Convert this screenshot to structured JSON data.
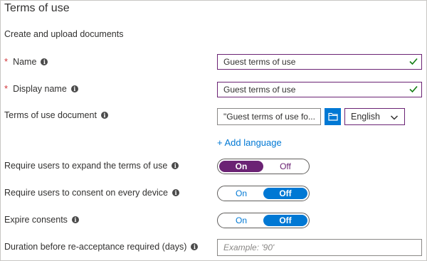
{
  "section": {
    "title": "Terms of use",
    "subtitle": "Create and upload documents"
  },
  "fields": {
    "name": {
      "label": "Name",
      "required": true,
      "value": "Guest terms of use"
    },
    "display_name": {
      "label": "Display name",
      "required": true,
      "value": "Guest terms of use"
    },
    "document": {
      "label": "Terms of use document",
      "file_value": "\"Guest terms of use fo...",
      "language": "English"
    },
    "add_language": "+ Add language",
    "expand": {
      "label": "Require users to expand the terms of use",
      "on_label": "On",
      "off_label": "Off",
      "selected": "On"
    },
    "consent_device": {
      "label": "Require users to consent on every device",
      "on_label": "On",
      "off_label": "Off",
      "selected": "Off"
    },
    "expire": {
      "label": "Expire consents",
      "on_label": "On",
      "off_label": "Off",
      "selected": "Off"
    },
    "duration": {
      "label": "Duration before re-acceptance required (days)",
      "placeholder": "Example: '90'"
    }
  },
  "icons": {
    "info": "info-icon",
    "check": "check-icon",
    "folder": "folder-icon",
    "chevron": "chevron-down-icon"
  },
  "colors": {
    "accent_purple": "#6b2374",
    "accent_blue": "#0078d4",
    "required_red": "#d13438",
    "valid_green": "#107c10"
  }
}
